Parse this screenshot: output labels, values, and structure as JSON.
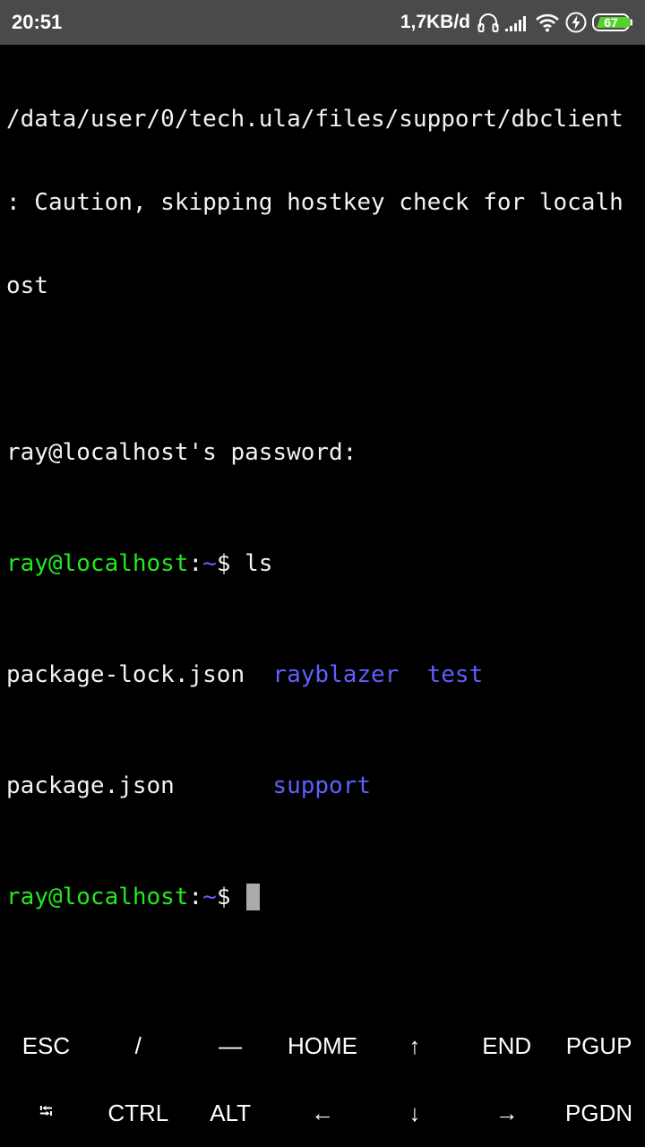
{
  "status_bar": {
    "time": "20:51",
    "net_speed": "1,7KB/d",
    "battery_level": "67",
    "icons": [
      "headphones-icon",
      "signal-icon",
      "wifi-icon",
      "charging-bolt-icon",
      "battery-icon"
    ]
  },
  "terminal": {
    "line1": "/data/user/0/tech.ula/files/support/dbclient",
    "line2": ": Caution, skipping hostkey check for localh",
    "line3": "ost",
    "line4": "",
    "line5": "ray@localhost's password:",
    "prompt_user": "ray@localhost",
    "prompt_colon": ":",
    "prompt_dir": "~",
    "prompt_symbol": "$",
    "command": " ls",
    "ls_files_row1": "package-lock.json  ",
    "ls_dir_rayblazer": "rayblazer",
    "ls_gap": "  ",
    "ls_dir_test": "test",
    "ls_files_row2": "package.json       ",
    "ls_dir_support": "support"
  },
  "extra_keys": {
    "row1": [
      "ESC",
      "/",
      "—",
      "HOME",
      "↑",
      "END",
      "PGUP"
    ],
    "row2": [
      "⭾",
      "CTRL",
      "ALT",
      "←",
      "↓",
      "→",
      "PGDN"
    ]
  },
  "colors": {
    "status_bar_bg": "#4a4a4a",
    "terminal_bg": "#000000",
    "prompt_user": "#23e81e",
    "prompt_dir": "#5f5fff",
    "directory": "#5f5fff",
    "battery_fill": "#55d12a"
  }
}
